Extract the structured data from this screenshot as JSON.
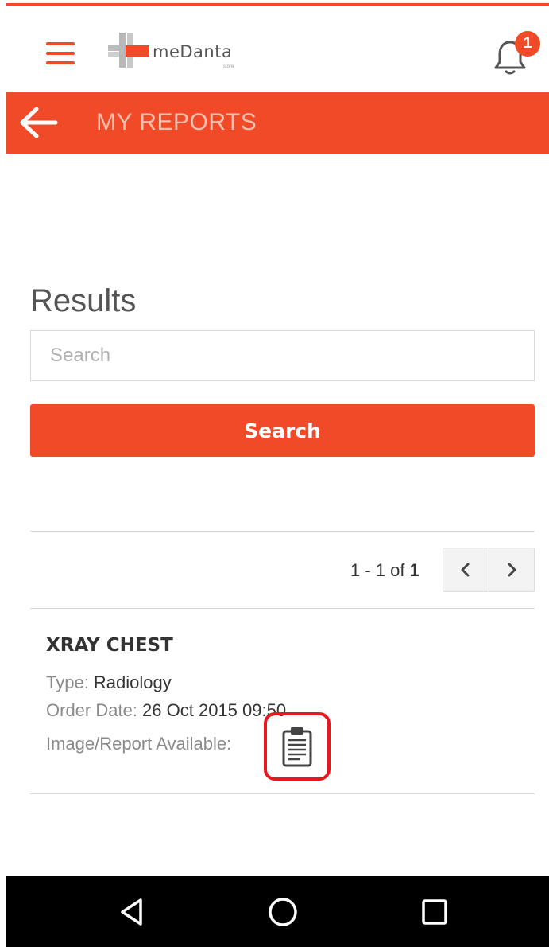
{
  "app": {
    "logo_text": "meDanta",
    "logo_sub": "store",
    "notification_count": "1",
    "brand_color": "#f04a28"
  },
  "title_bar": {
    "back_icon": "arrow-left-icon",
    "title": "MY REPORTS"
  },
  "results": {
    "heading": "Results",
    "search_placeholder": "Search",
    "search_value": "",
    "search_button_label": "Search"
  },
  "pagination": {
    "range": "1 - 1 of ",
    "total": "1",
    "prev_icon": "chevron-left-icon",
    "next_icon": "chevron-right-icon"
  },
  "reports": [
    {
      "title": "XRAY CHEST",
      "type_label": "Type: ",
      "type_value": "Radiology",
      "order_date_label": "Order Date: ",
      "order_date_value": "26 Oct 2015 09:50",
      "availability_label": "Image/Report Available:",
      "report_icon": "clipboard-icon",
      "highlight_color": "#e8161d"
    }
  ],
  "nav_bar": {
    "back_icon": "triangle-back-icon",
    "home_icon": "circle-home-icon",
    "recents_icon": "square-recents-icon"
  }
}
